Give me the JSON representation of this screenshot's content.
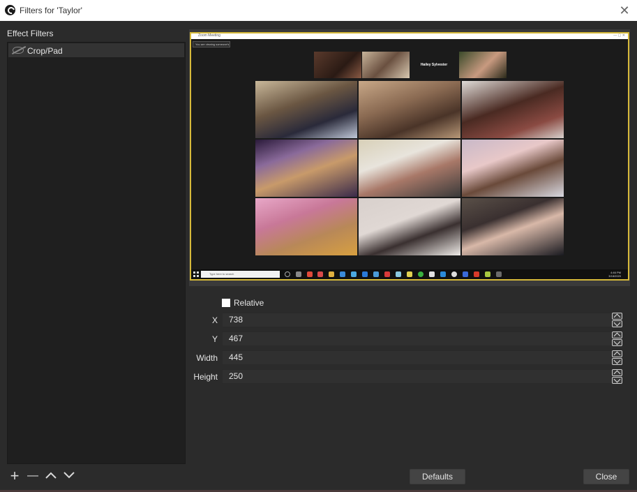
{
  "window": {
    "title": "Filters for 'Taylor'"
  },
  "left_panel": {
    "header": "Effect Filters",
    "filters": [
      {
        "label": "Crop/Pad",
        "visible": true
      }
    ],
    "buttons": {
      "add": "+",
      "remove": "—"
    }
  },
  "preview": {
    "inner_window_title": "Zoom Meeting",
    "dropdown_label": "You are viewing someone's",
    "participant_name": "Hailey Sylvester",
    "taskbar": {
      "search_placeholder": "Type here to search",
      "clock_time": "4:46 PM",
      "clock_date": "3/18/2020"
    }
  },
  "properties": {
    "relative_label": "Relative",
    "relative_checked": false,
    "fields": [
      {
        "label": "X",
        "value": "738"
      },
      {
        "label": "Y",
        "value": "467"
      },
      {
        "label": "Width",
        "value": "445"
      },
      {
        "label": "Height",
        "value": "250"
      }
    ]
  },
  "footer": {
    "defaults_label": "Defaults",
    "close_label": "Close"
  },
  "colors": {
    "preview_border": "#d6b93a",
    "background": "#2b2b2b",
    "list_bg": "#1f1f1f"
  }
}
